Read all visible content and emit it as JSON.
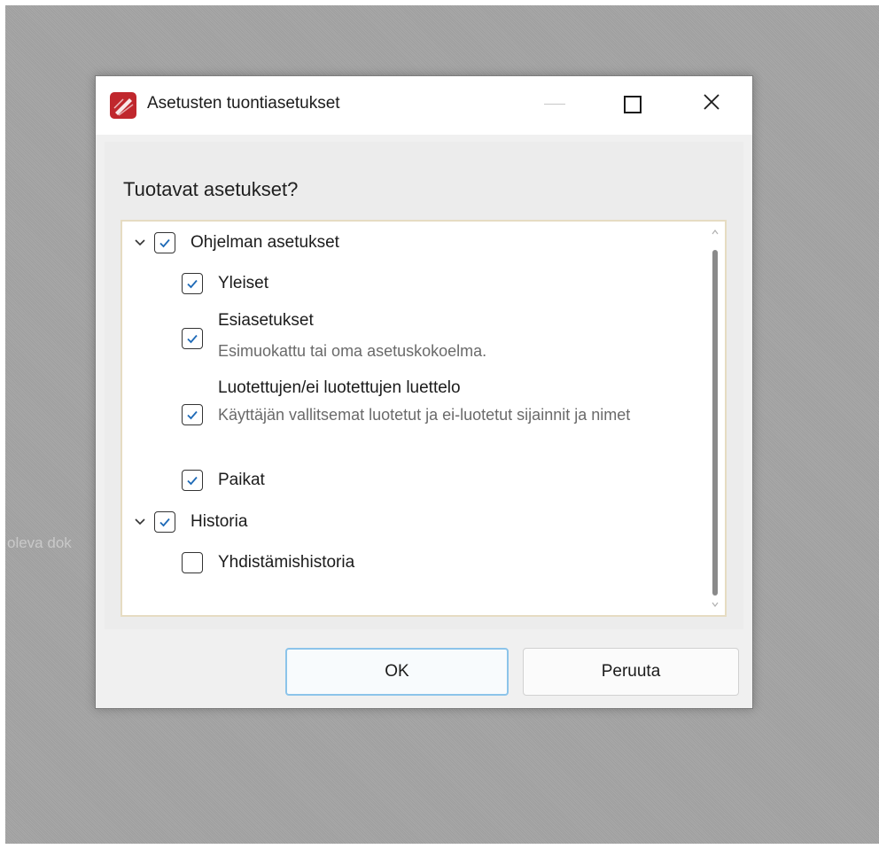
{
  "background_fragment": "oleva dok",
  "dialog": {
    "title": "Asetusten tuontiasetukset",
    "question": "Tuotavat asetukset?",
    "tree": [
      {
        "label": "Ohjelman asetukset",
        "checked": true,
        "expanded": true
      },
      {
        "label": "Yleiset",
        "checked": true
      },
      {
        "label": "Esiasetukset",
        "description": "Esimuokattu tai oma asetuskokoelma.",
        "checked": true
      },
      {
        "label": "Luotettujen/ei luotettujen luettelo",
        "description": "Käyttäjän vallitsemat luotetut ja ei-luotetut sijainnit ja nimet",
        "checked": true
      },
      {
        "label": "Paikat",
        "checked": true
      },
      {
        "label": "Historia",
        "checked": true,
        "expanded": true
      },
      {
        "label": "Yhdistämishistoria",
        "checked": false
      }
    ],
    "ok_label": "OK",
    "cancel_label": "Peruuta"
  },
  "colors": {
    "checkmark": "#1e6ab7",
    "focus_border": "#8cc4ea",
    "tree_border": "#e6dcc2",
    "app_icon_red": "#c0272d"
  },
  "icons": {
    "app": "pdf-app-icon",
    "minimize": "minimize-icon",
    "maximize": "maximize-icon",
    "close": "close-icon",
    "expander": "chevron-down-icon",
    "checkmark": "checkmark-icon"
  }
}
